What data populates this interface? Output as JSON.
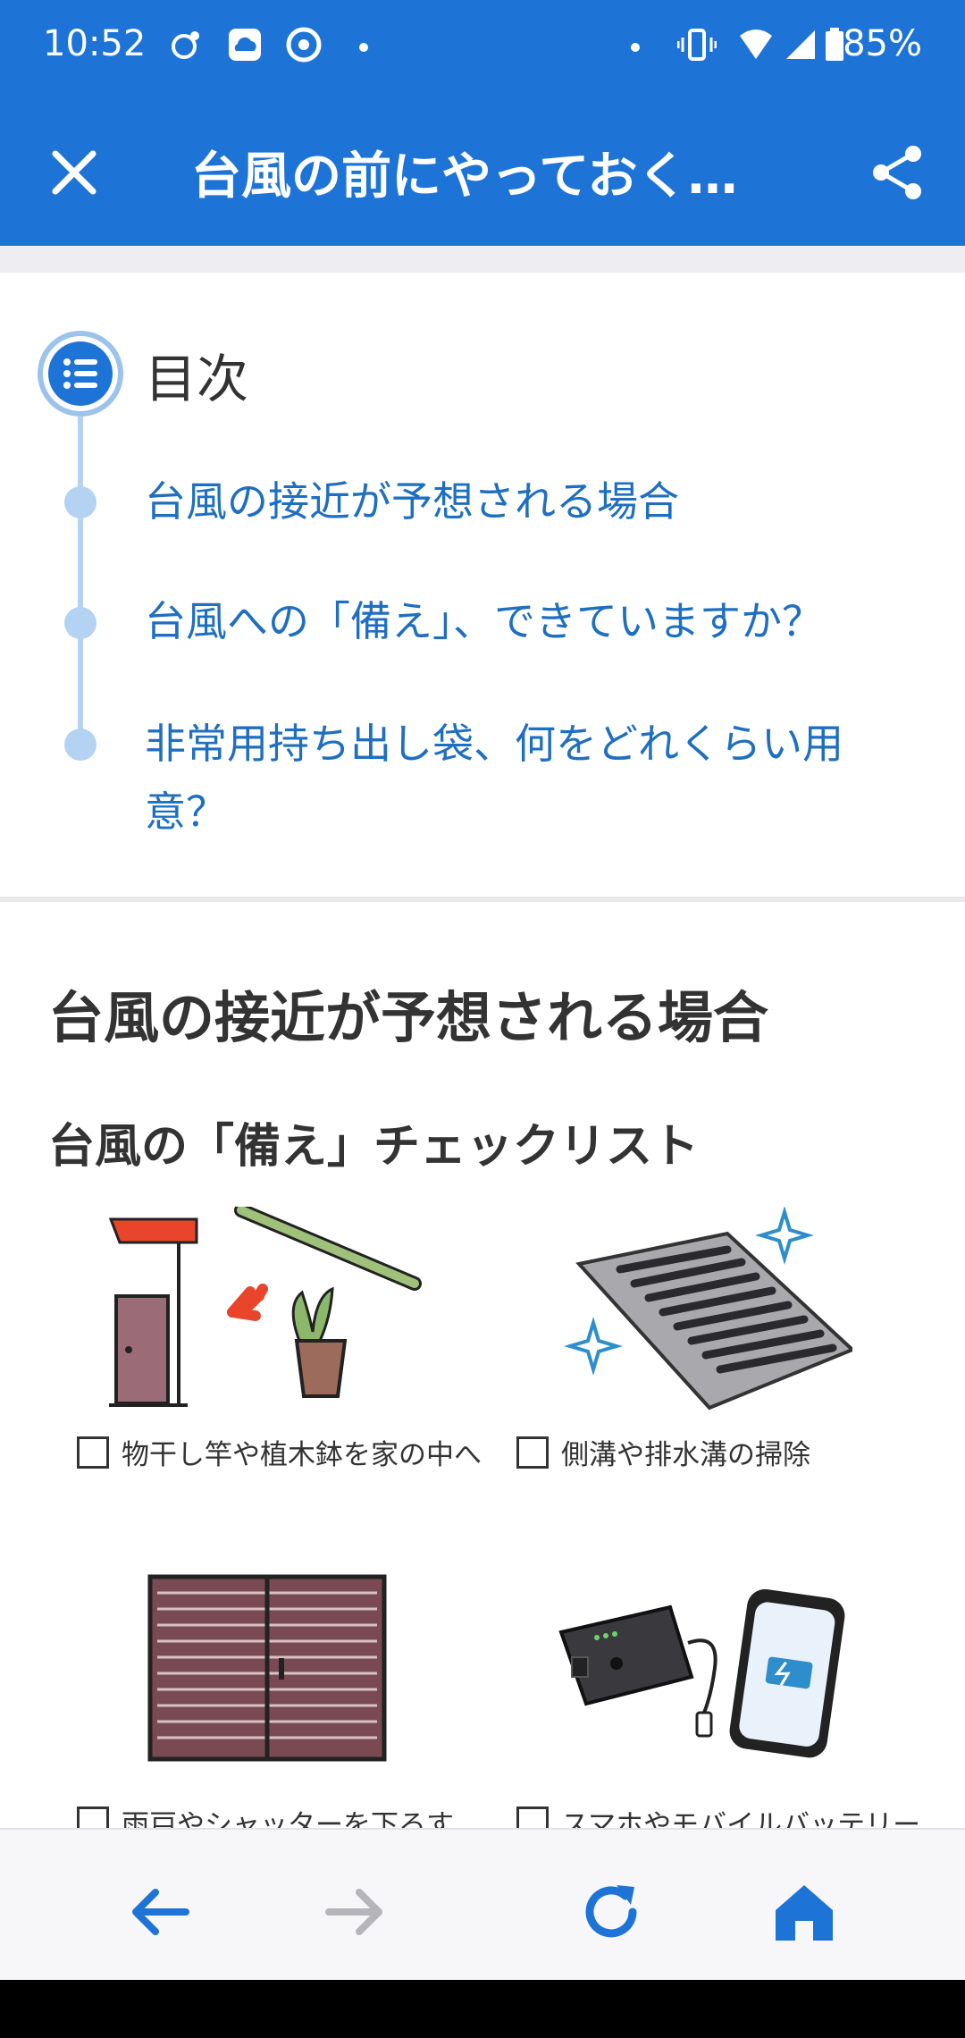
{
  "status": {
    "time": "10:52",
    "battery": "85%"
  },
  "appbar": {
    "title": "台風の前にやっておく…"
  },
  "toc": {
    "heading": "目次",
    "items": [
      "台風の接近が予想される場合",
      "台風への「備え」、できていますか？",
      "非常用持ち出し袋、何をどれくらい用意？"
    ]
  },
  "article": {
    "h2": "台風の接近が予想される場合",
    "h3": "台風の「備え」チェックリスト",
    "checklist": [
      "物干し竿や植木鉢を家の中へ",
      "側溝や排水溝の掃除",
      "雨戸やシャッターを下ろす",
      "スマホやモバイルバッテリー"
    ]
  },
  "colors": {
    "brand": "#1e74d6",
    "link": "#1f6fc0",
    "toc_line": "#b4d2f2"
  },
  "icons": [
    "close-icon",
    "share-icon",
    "list-icon",
    "back-icon",
    "forward-icon",
    "reload-icon",
    "home-icon"
  ]
}
